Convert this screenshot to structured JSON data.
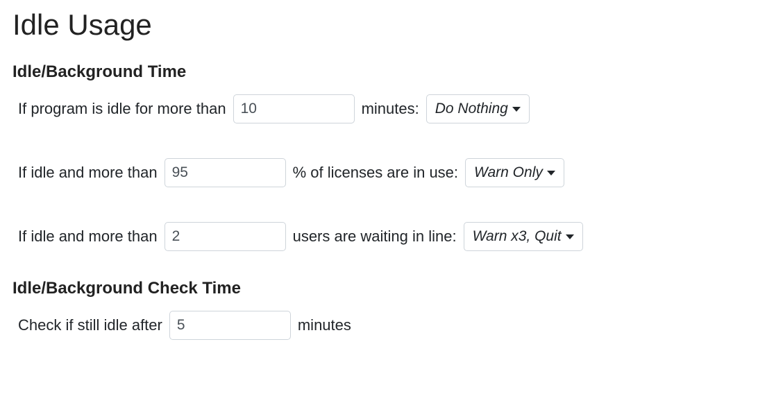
{
  "page": {
    "title": "Idle Usage"
  },
  "sections": {
    "idle_time": {
      "heading": "Idle/Background Time",
      "row1": {
        "prefix": "If program is idle for more than",
        "value": "10",
        "suffix": "minutes:",
        "action": "Do Nothing"
      },
      "row2": {
        "prefix": "If idle and more than",
        "value": "95",
        "suffix": "% of licenses are in use:",
        "action": "Warn Only"
      },
      "row3": {
        "prefix": "If idle and more than",
        "value": "2",
        "suffix": "users are waiting in line:",
        "action": "Warn x3, Quit"
      }
    },
    "check_time": {
      "heading": "Idle/Background Check Time",
      "row1": {
        "prefix": "Check if still idle after",
        "value": "5",
        "suffix": "minutes"
      }
    }
  }
}
